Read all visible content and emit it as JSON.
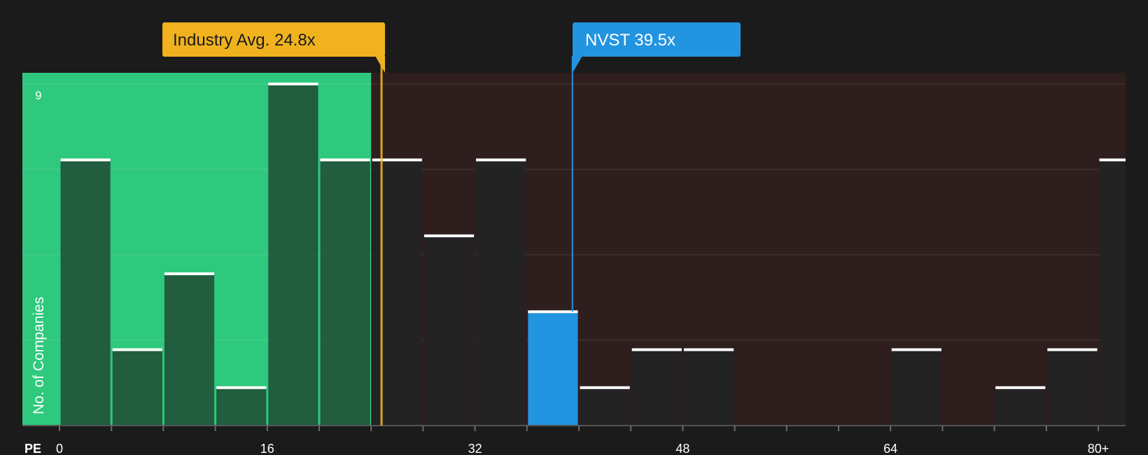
{
  "colors": {
    "background": "#1b1b1b",
    "undervalued_zone": "#2ec97c",
    "overvalued_zone": "#2f1e1e",
    "bar_fill": "#232323",
    "bar_fill_in_green": "#1f4a34",
    "highlight": "#2394e0",
    "industry_marker": "#f0b21e",
    "bar_cap": "#ffffff",
    "text": "#ffffff"
  },
  "callouts": {
    "industry": "Industry Avg. 24.8x",
    "company": "NVST 39.5x"
  },
  "chart_data": {
    "type": "bar",
    "xlabel": "PE",
    "ylabel": "No. of Companies",
    "x_ticks": [
      "0",
      "16",
      "32",
      "48",
      "64",
      "80+"
    ],
    "x_tick_values": [
      0,
      16,
      32,
      48,
      64,
      80
    ],
    "y_tick_labels": [
      "9"
    ],
    "ylim": [
      0,
      9
    ],
    "bin_width": 4,
    "bins": [
      {
        "start": 0,
        "count": 7
      },
      {
        "start": 4,
        "count": 2
      },
      {
        "start": 8,
        "count": 4
      },
      {
        "start": 12,
        "count": 1
      },
      {
        "start": 16,
        "count": 9
      },
      {
        "start": 20,
        "count": 7
      },
      {
        "start": 24,
        "count": 7
      },
      {
        "start": 28,
        "count": 5
      },
      {
        "start": 32,
        "count": 7
      },
      {
        "start": 36,
        "count": 3,
        "highlight": true
      },
      {
        "start": 40,
        "count": 1
      },
      {
        "start": 44,
        "count": 2
      },
      {
        "start": 48,
        "count": 2
      },
      {
        "start": 52,
        "count": 0
      },
      {
        "start": 56,
        "count": 0
      },
      {
        "start": 60,
        "count": 0
      },
      {
        "start": 64,
        "count": 2
      },
      {
        "start": 68,
        "count": 0
      },
      {
        "start": 72,
        "count": 1
      },
      {
        "start": 76,
        "count": 2
      },
      {
        "start": 80,
        "count": 7
      }
    ],
    "industry_average": 24.8,
    "company_value": 39.5,
    "company_ticker": "NVST",
    "undervalued_until": 24,
    "grid": true,
    "legend": "none"
  }
}
